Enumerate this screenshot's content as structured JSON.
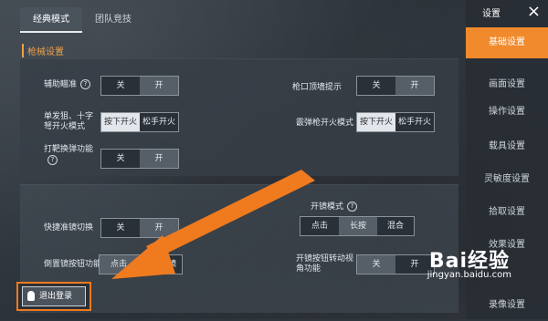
{
  "tabs": [
    "经典模式",
    "团队竞技"
  ],
  "section_title": "枪械设置",
  "panel1": {
    "rows": [
      {
        "label": "辅助瞄准",
        "options": [
          "关",
          "开"
        ]
      },
      {
        "label": "单发狙、十字弩开火模式",
        "options": [
          "按下开火",
          "松手开火"
        ]
      },
      {
        "label": "打靶换弹功能",
        "options": [
          "关",
          "开"
        ]
      },
      {
        "label": "枪口顶墙提示",
        "options": [
          "关",
          "开"
        ]
      },
      {
        "label": "霰弹枪开火模式",
        "options": [
          "按下开火",
          "松手开火"
        ]
      }
    ]
  },
  "panel2": {
    "rows": [
      {
        "label": "快捷准镜切换",
        "options": [
          "关",
          "开"
        ]
      },
      {
        "label": "倒置镜按钮功能",
        "options": [
          "点击",
          "点击切镜"
        ]
      },
      {
        "label": "开镜模式",
        "options": [
          "点击",
          "长按",
          "混合"
        ]
      },
      {
        "label": "开镜按钮转动视角功能",
        "options": [
          "关",
          "开"
        ]
      }
    ]
  },
  "sidebar": {
    "title": "设置",
    "close": "×",
    "items": [
      "基础设置",
      "画面设置",
      "操作设置",
      "载具设置",
      "灵敏度设置",
      "拾取设置",
      "效果设置",
      "录像设置"
    ]
  },
  "logout_label": "退出登录",
  "watermark": {
    "brand": "Bai经验",
    "url": "jingyan.baidu.com"
  },
  "colors": {
    "accent": "#f08a2c",
    "arrow": "#f07a1e"
  }
}
